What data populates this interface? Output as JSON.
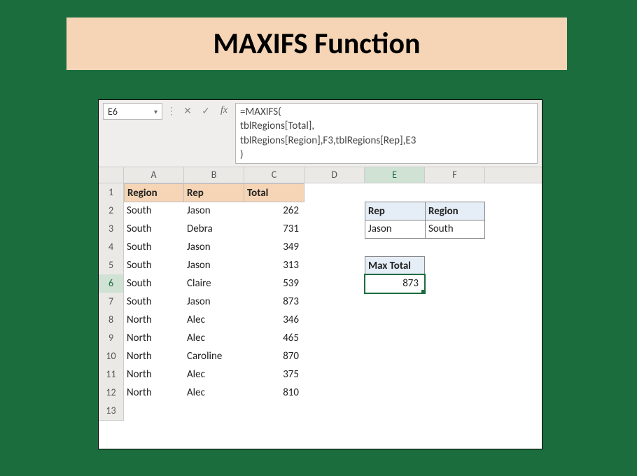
{
  "title": "MAXIFS Function",
  "formula_bar": {
    "name_box": "E6",
    "formula": "=MAXIFS(\ntblRegions[Total],\ntblRegions[Region],F3,tblRegions[Rep],E3\n)"
  },
  "columns": [
    "A",
    "B",
    "C",
    "D",
    "E",
    "F"
  ],
  "selected_col": "E",
  "selected_row": 6,
  "table_headers": {
    "a": "Region",
    "b": "Rep",
    "c": "Total"
  },
  "table_rows": [
    {
      "region": "South",
      "rep": "Jason",
      "total": "262"
    },
    {
      "region": "South",
      "rep": "Debra",
      "total": "731"
    },
    {
      "region": "South",
      "rep": "Jason",
      "total": "349"
    },
    {
      "region": "South",
      "rep": "Jason",
      "total": "313"
    },
    {
      "region": "South",
      "rep": "Claire",
      "total": "539"
    },
    {
      "region": "South",
      "rep": "Jason",
      "total": "873"
    },
    {
      "region": "North",
      "rep": "Alec",
      "total": "346"
    },
    {
      "region": "North",
      "rep": "Alec",
      "total": "465"
    },
    {
      "region": "North",
      "rep": "Caroline",
      "total": "870"
    },
    {
      "region": "North",
      "rep": "Alec",
      "total": "375"
    },
    {
      "region": "North",
      "rep": "Alec",
      "total": "810"
    }
  ],
  "side_box": {
    "rep_header": "Rep",
    "region_header": "Region",
    "rep_value": "Jason",
    "region_value": "South",
    "max_total_header": "Max Total",
    "max_total_value": "873"
  }
}
